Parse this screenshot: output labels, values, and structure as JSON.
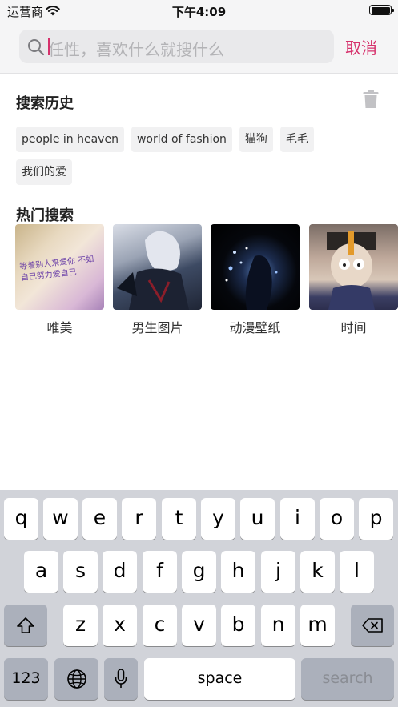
{
  "status_bar": {
    "carrier": "运营商",
    "time": "下午4:09"
  },
  "search": {
    "placeholder": "任性，喜欢什么就搜什么",
    "cancel_label": "取消"
  },
  "history": {
    "title": "搜索历史",
    "tags": [
      "people in heaven",
      "world of fashion",
      "猫狗",
      "毛毛",
      "我们的爱"
    ]
  },
  "hot": {
    "title": "热门搜索",
    "items": [
      {
        "label": "唯美",
        "thumb_text": "等着别人来爱你 不如自己努力爱自己"
      },
      {
        "label": "男生图片"
      },
      {
        "label": "动漫壁纸"
      },
      {
        "label": "时间"
      }
    ]
  },
  "keyboard": {
    "row1": [
      "q",
      "w",
      "e",
      "r",
      "t",
      "y",
      "u",
      "i",
      "o",
      "p"
    ],
    "row2": [
      "a",
      "s",
      "d",
      "f",
      "g",
      "h",
      "j",
      "k",
      "l"
    ],
    "row3": [
      "z",
      "x",
      "c",
      "v",
      "b",
      "n",
      "m"
    ],
    "numbers_label": "123",
    "space_label": "space",
    "search_label": "search"
  },
  "colors": {
    "accent": "#d6316c",
    "keyboard_bg": "#d1d3d9",
    "tag_bg": "#f1f1f2"
  }
}
